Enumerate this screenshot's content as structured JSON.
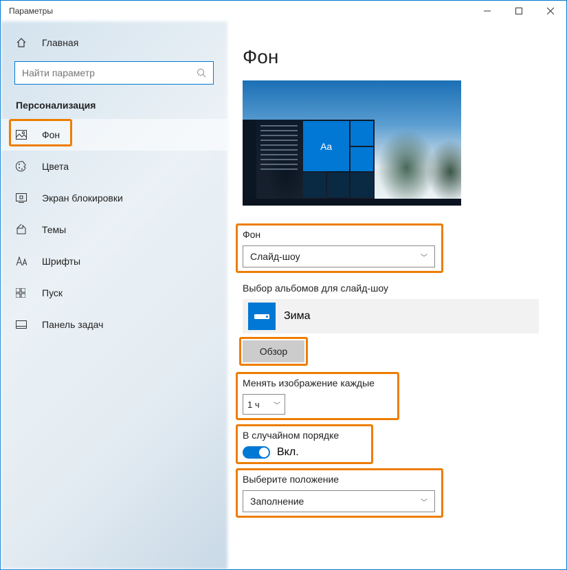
{
  "window": {
    "title": "Параметры"
  },
  "sidebar": {
    "home": "Главная",
    "search_placeholder": "Найти параметр",
    "section": "Персонализация",
    "items": [
      {
        "label": "Фон"
      },
      {
        "label": "Цвета"
      },
      {
        "label": "Экран блокировки"
      },
      {
        "label": "Темы"
      },
      {
        "label": "Шрифты"
      },
      {
        "label": "Пуск"
      },
      {
        "label": "Панель задач"
      }
    ]
  },
  "main": {
    "heading": "Фон",
    "preview_sample": "Aa",
    "bg_label": "Фон",
    "bg_value": "Слайд-шоу",
    "album_label": "Выбор альбомов для слайд-шоу",
    "album_name": "Зима",
    "browse": "Обзор",
    "change_label": "Менять изображение каждые",
    "change_value": "1 ч",
    "shuffle_label": "В случайном порядке",
    "shuffle_value": "Вкл.",
    "fit_label": "Выберите положение",
    "fit_value": "Заполнение"
  }
}
